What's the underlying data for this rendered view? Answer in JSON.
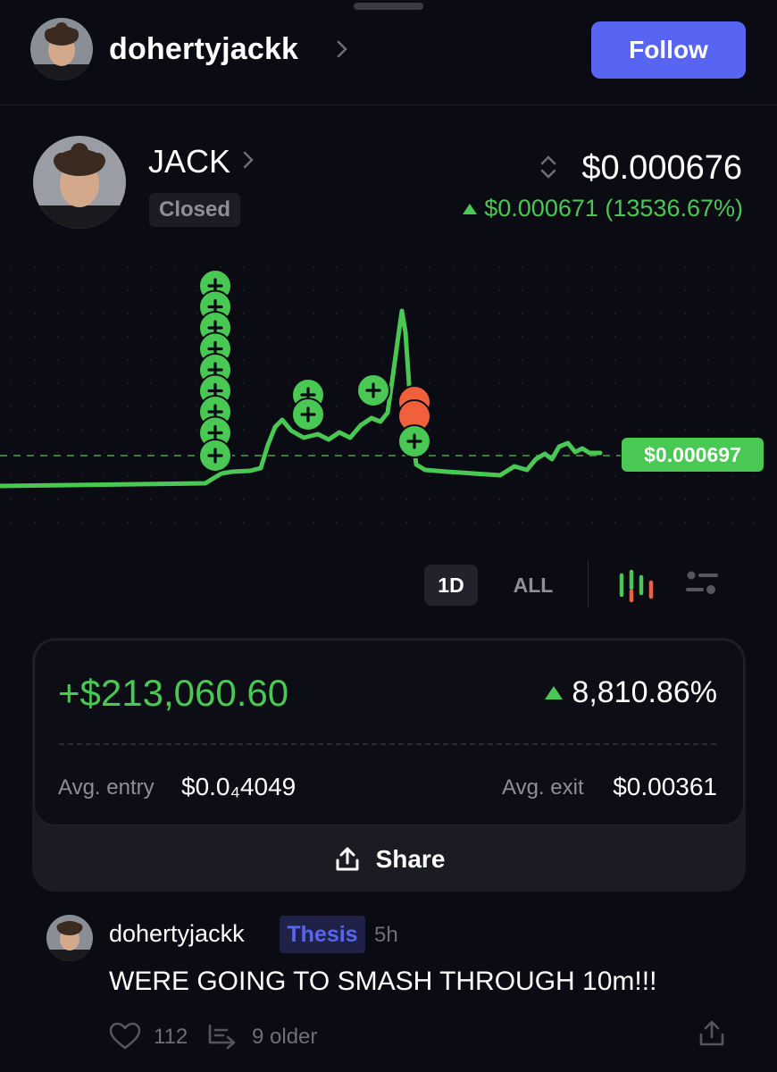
{
  "header": {
    "username": "dohertyjackk",
    "follow_label": "Follow"
  },
  "token": {
    "name": "JACK",
    "status": "Closed",
    "price": "$0.000676",
    "change": "$0.000671 (13536.67%)",
    "current_price_tag": "$0.000697"
  },
  "chart_controls": {
    "range_1d": "1D",
    "range_all": "ALL",
    "selected_range": "1D",
    "icons": [
      "candlestick-icon",
      "scatter-toggle-icon"
    ]
  },
  "chart_data": {
    "type": "line",
    "title": "",
    "xlabel": "",
    "ylabel": "",
    "current_value_label": "$0.000697",
    "markers": {
      "buys": 12,
      "sells": 2
    }
  },
  "position": {
    "pnl": "+$213,060.60",
    "pnl_pct": "8,810.86%",
    "avg_entry_label": "Avg. entry",
    "avg_entry_value": "$0.0₄4049",
    "avg_exit_label": "Avg. exit",
    "avg_exit_value": "$0.00361",
    "share_label": "Share"
  },
  "post": {
    "username": "dohertyjackk",
    "tag": "Thesis",
    "time": "5h",
    "text": "WERE GOING TO SMASH THROUGH 10m!!!",
    "likes": "112",
    "thread_label": "9 older"
  },
  "colors": {
    "background": "#0b0b14",
    "accent": "#5865f2",
    "up": "#49c854",
    "down": "#f0603a"
  }
}
